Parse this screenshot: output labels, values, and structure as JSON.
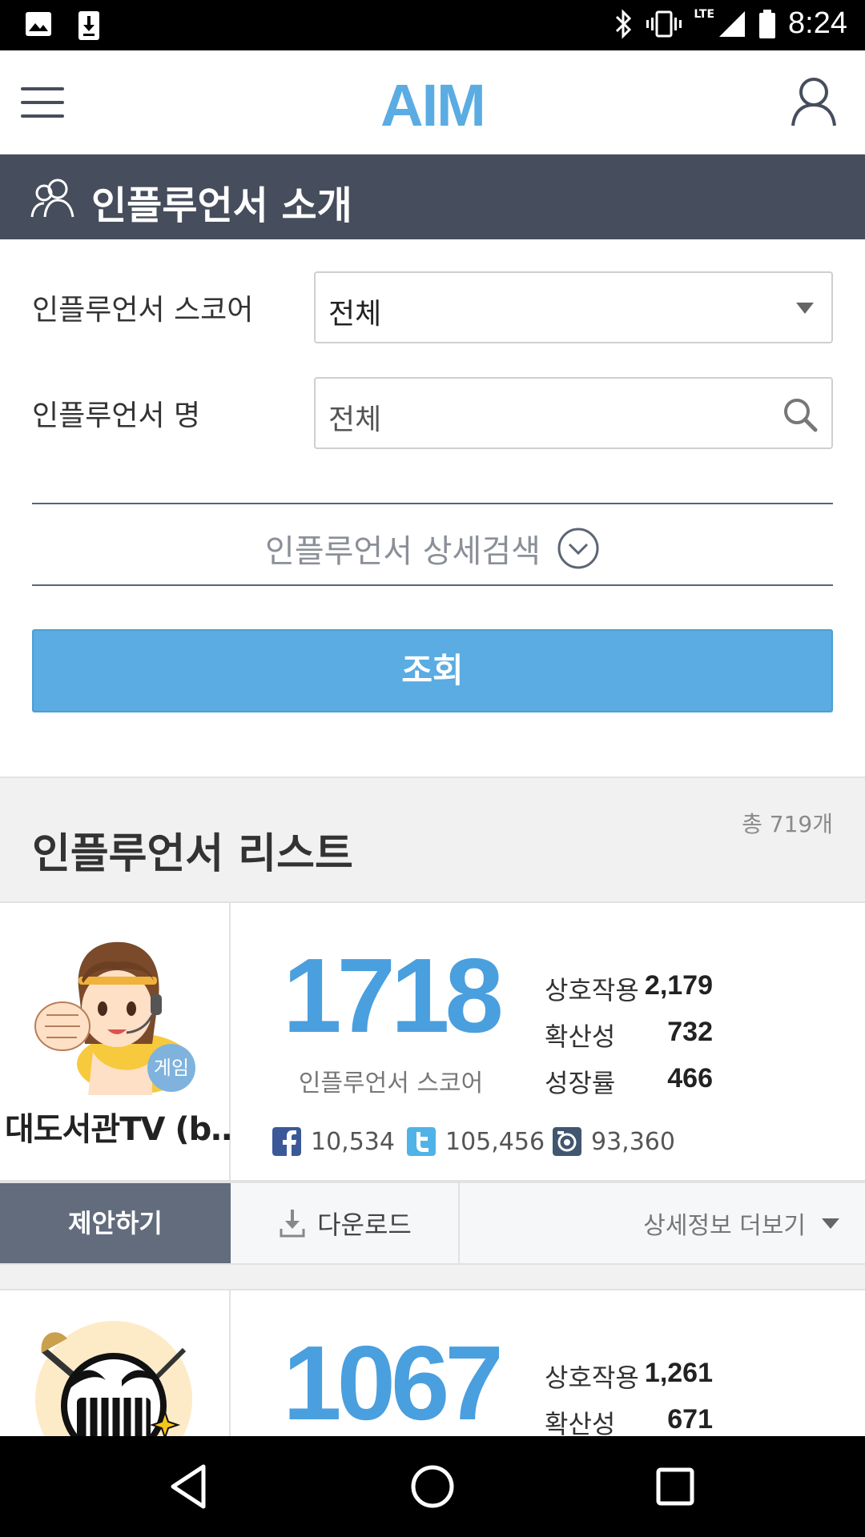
{
  "status_bar": {
    "time": "8:24",
    "network": "LTE",
    "left_icons": [
      "image-notification-icon",
      "download-notification-icon"
    ],
    "right_icons": [
      "bluetooth-icon",
      "vibrate-icon",
      "signal-icon",
      "battery-icon"
    ]
  },
  "header": {
    "logo": "AIM",
    "menu_icon": "hamburger-menu-icon",
    "user_icon": "user-profile-icon"
  },
  "banner": {
    "title": "인플루언서 소개",
    "icon": "people-icon"
  },
  "filters": {
    "score_label": "인플루언서 스코어",
    "score_value": "전체",
    "name_label": "인플루언서 명",
    "name_placeholder": "전체",
    "advanced_search": "인플루언서 상세검색",
    "submit": "조회"
  },
  "list": {
    "title": "인플루언서 리스트",
    "total": "총 719개",
    "items": [
      {
        "name": "대도서관TV (b…",
        "category": "게임",
        "score": "1718",
        "score_label": "인플루언서 스코어",
        "metrics": [
          {
            "label": "상호작용",
            "value": "2,179"
          },
          {
            "label": "확산성",
            "value": "732"
          },
          {
            "label": "성장률",
            "value": "466"
          }
        ],
        "social": [
          {
            "icon": "facebook-icon",
            "value": "10,534",
            "color": "#3b5998"
          },
          {
            "icon": "twitter-icon",
            "value": "105,456",
            "color": "#4fb3e8"
          },
          {
            "icon": "video-icon",
            "value": "93,360",
            "color": "#41566f"
          }
        ],
        "actions": {
          "propose": "제안하기",
          "download": "다운로드",
          "more": "상세정보 더보기"
        }
      },
      {
        "score": "1067",
        "metrics": [
          {
            "label": "상호작용",
            "value": "1,261"
          },
          {
            "label": "확산성",
            "value": "671"
          }
        ]
      }
    ]
  },
  "colors": {
    "accent": "#5aace2",
    "score": "#4a9fde",
    "banner": "#464d5c",
    "propose": "#636c7c"
  }
}
